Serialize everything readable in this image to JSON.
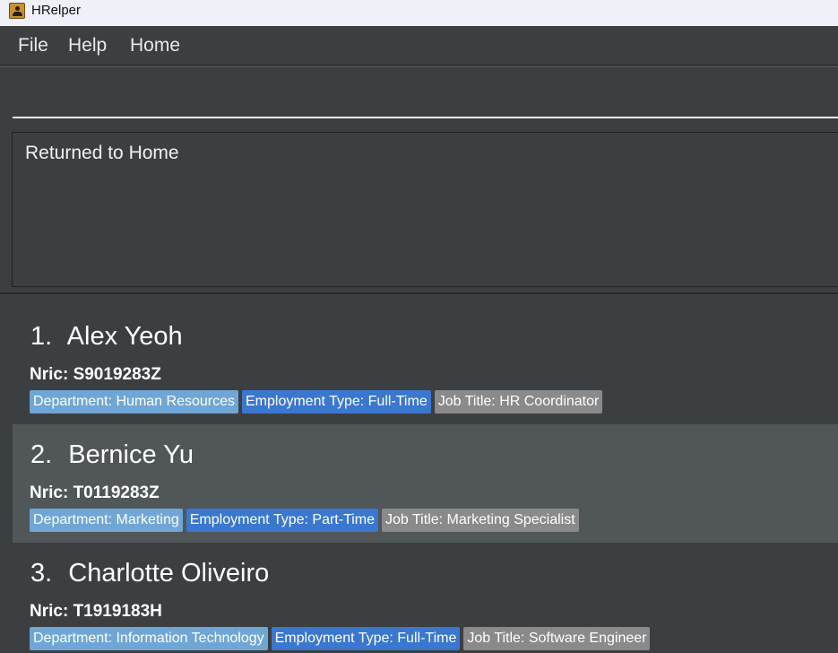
{
  "window": {
    "title": "HRelper"
  },
  "menu": {
    "file": "File",
    "help": "Help",
    "home": "Home"
  },
  "command": {
    "value": "",
    "placeholder": ""
  },
  "result": {
    "message": "Returned to Home"
  },
  "persons": [
    {
      "index": "1.",
      "name": "Alex Yeoh",
      "nric": "Nric: S9019283Z",
      "department": "Department: Human Resources",
      "employment_type": "Employment Type: Full-Time",
      "job_title": "Job Title: HR Coordinator"
    },
    {
      "index": "2.",
      "name": "Bernice Yu",
      "nric": "Nric: T0119283Z",
      "department": "Department: Marketing",
      "employment_type": "Employment Type: Part-Time",
      "job_title": "Job Title: Marketing Specialist"
    },
    {
      "index": "3.",
      "name": "Charlotte Oliveiro",
      "nric": "Nric: T1919183H",
      "department": "Department: Information Technology",
      "employment_type": "Employment Type: Full-Time",
      "job_title": "Job Title: Software Engineer"
    }
  ],
  "colors": {
    "background": "#3c3f41",
    "selected_row": "#515658",
    "department_tag": "#6fa6d6",
    "employment_tag": "#3a77cf",
    "job_title_tag": "#8a8a8a"
  }
}
